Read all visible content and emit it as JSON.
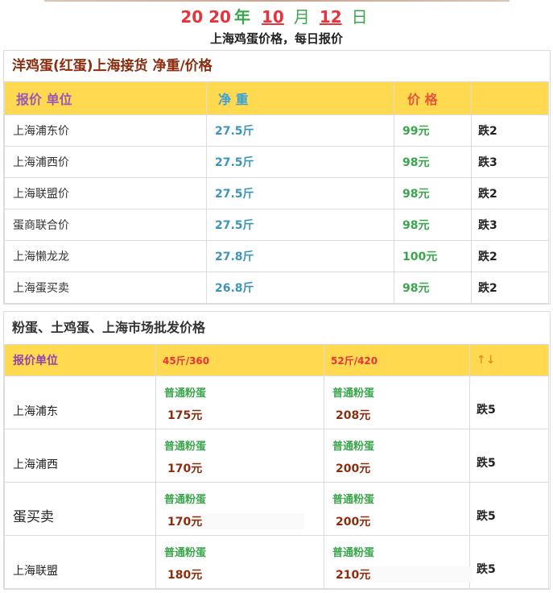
{
  "header": {
    "year_a": "20",
    "year_b": "20",
    "year_label": "年",
    "month": "10",
    "month_label": "月",
    "day": "12",
    "day_label": "日",
    "subtitle": "上海鸡蛋价格，每日报价"
  },
  "section1": {
    "title": "洋鸡蛋(红蛋)上海接货 净重/价格",
    "headers": [
      "报价 单位",
      "净 重",
      "价 格",
      ""
    ],
    "rows": [
      {
        "name": "上海浦东价",
        "weight": "27.5斤",
        "price": "99元",
        "change": "跌2"
      },
      {
        "name": "上海浦西价",
        "weight": "27.5斤",
        "price": "98元",
        "change": "跌3"
      },
      {
        "name": "上海联盟价",
        "weight": "27.5斤",
        "price": "98元",
        "change": "跌2"
      },
      {
        "name": "蛋商联合价",
        "weight": "27.5斤",
        "price": "98元",
        "change": "跌3"
      },
      {
        "name": "上海懒龙龙",
        "weight": "27.8斤",
        "price": "100元",
        "change": "跌2"
      },
      {
        "name": "上海蛋买卖",
        "weight": "26.8斤",
        "price": "98元",
        "change": "跌2"
      }
    ]
  },
  "section2": {
    "title": "粉蛋、土鸡蛋、上海市场批发价格",
    "headers": [
      "报价单位",
      "45斤/360",
      "52斤/420",
      "↑↓"
    ],
    "rows": [
      {
        "name": "上海浦东",
        "label_a": "普通粉蛋",
        "price_a": "175元",
        "label_b": "普通粉蛋",
        "price_b": "208元",
        "change": "跌5"
      },
      {
        "name": "上海浦西",
        "label_a": "普通粉蛋",
        "price_a": "170元",
        "label_b": "普通粉蛋",
        "price_b": "200元",
        "change": "跌5"
      },
      {
        "name": "蛋买卖",
        "label_a": "普通粉蛋",
        "price_a": "170元",
        "label_b": "普通粉蛋",
        "price_b": "200元",
        "change": "跌5"
      },
      {
        "name": "上海联盟",
        "label_a": "普通粉蛋",
        "price_a": "180元",
        "label_b": "普通粉蛋",
        "price_b": "210元",
        "change": "跌5"
      }
    ]
  }
}
